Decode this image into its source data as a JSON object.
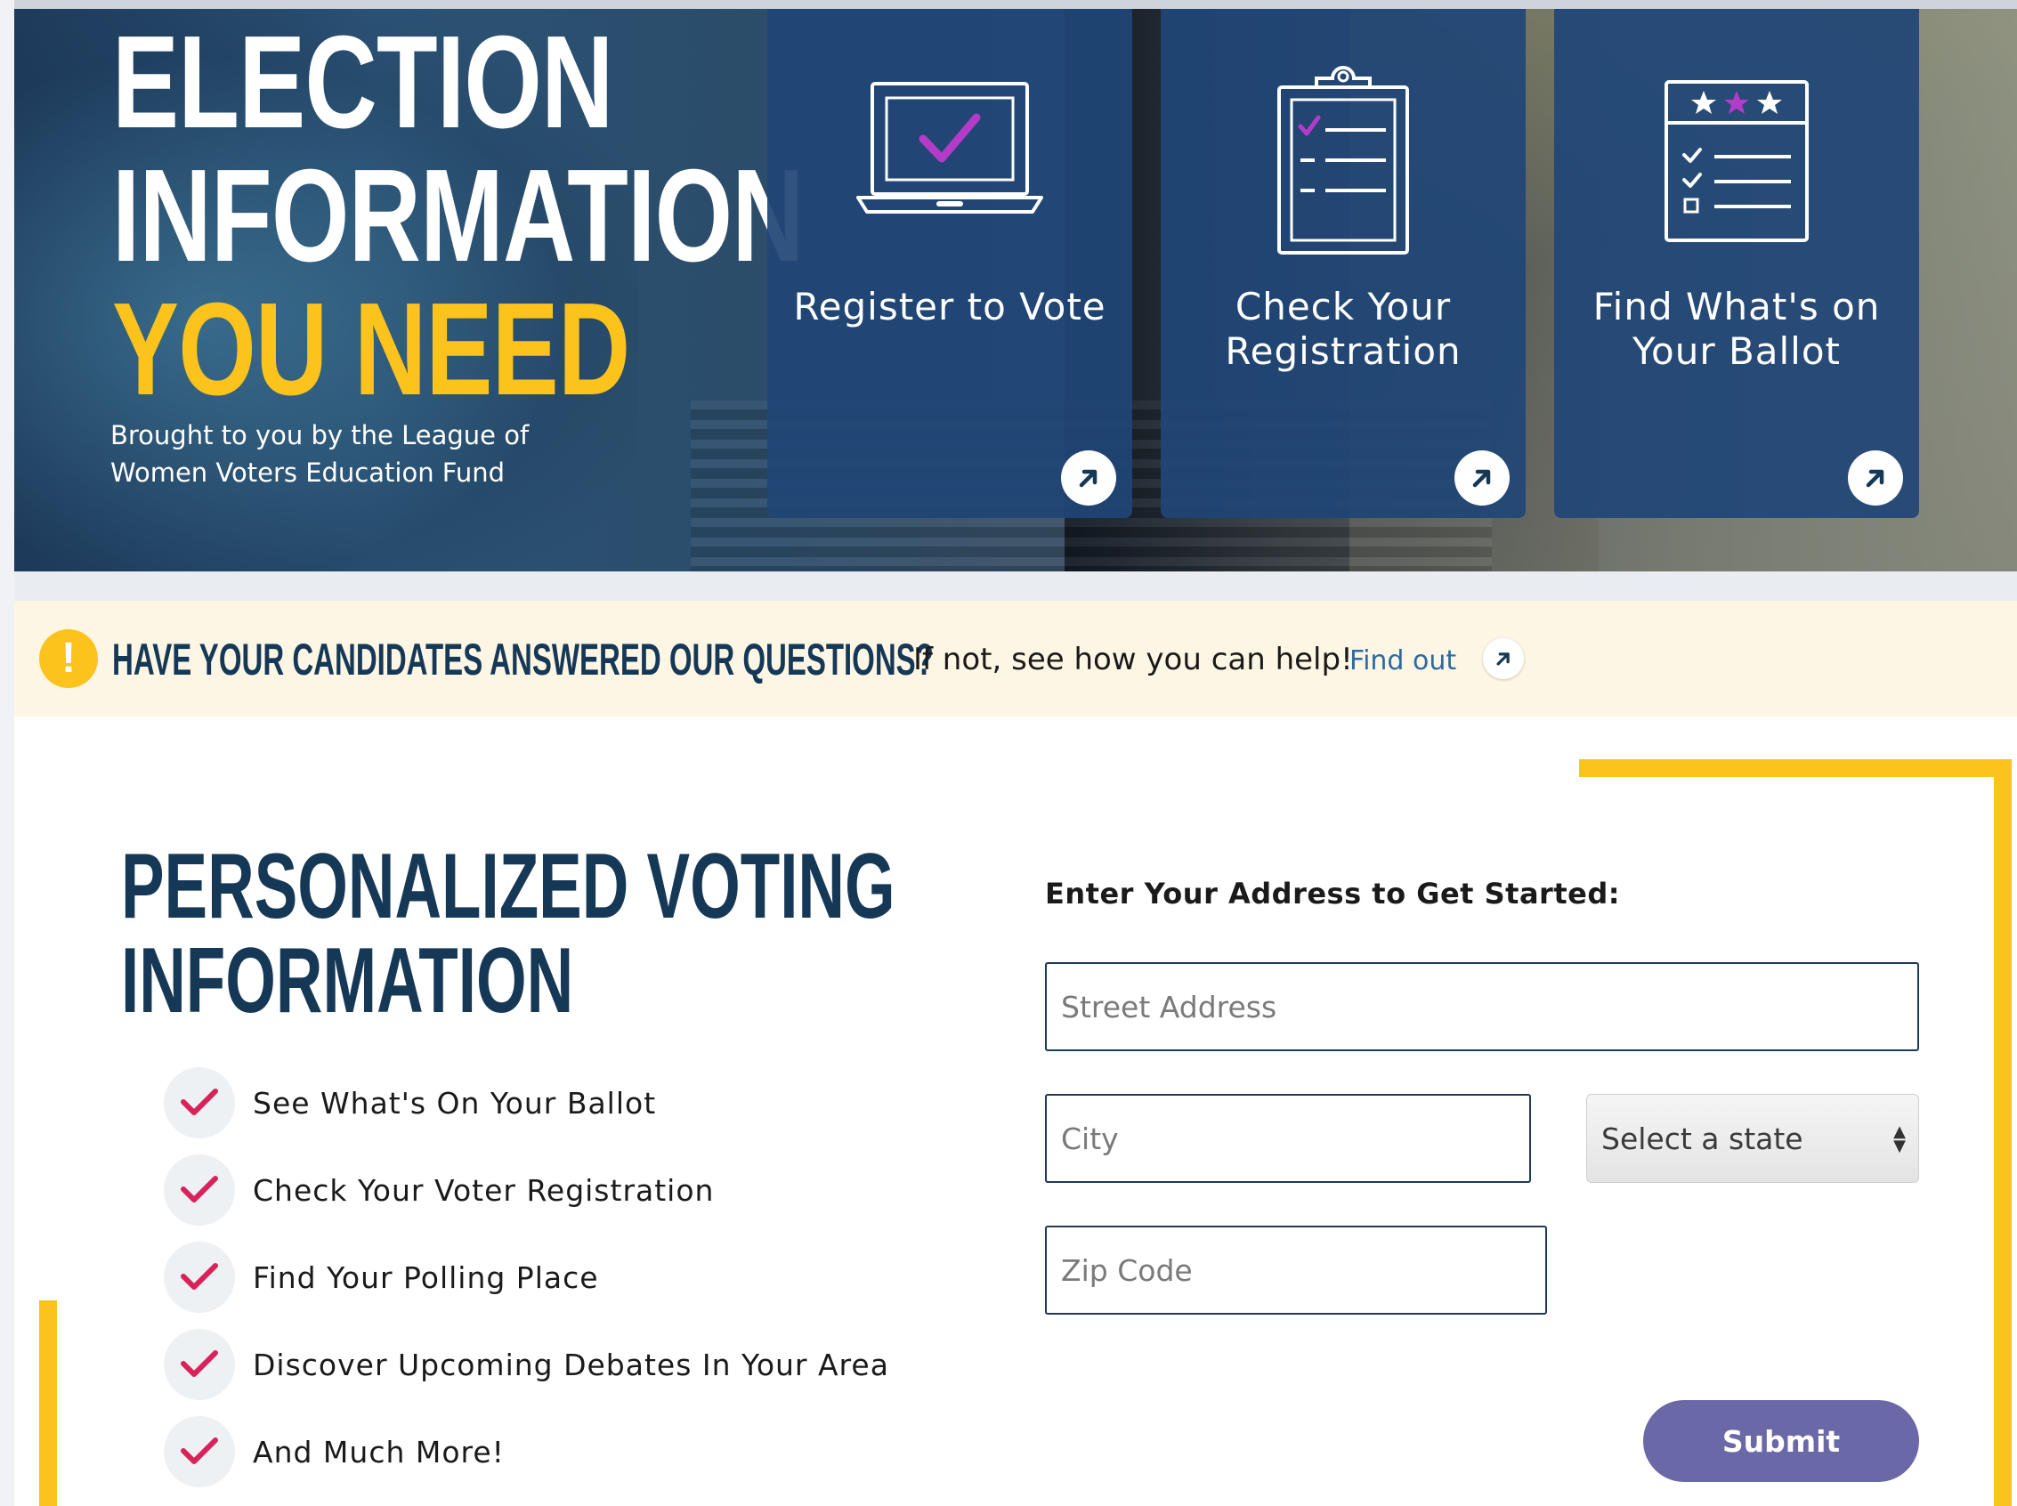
{
  "hero": {
    "title_line1": "ELECTION",
    "title_line2": "INFORMATION",
    "title_line3": "YOU NEED",
    "subtitle": "Brought to you by the League of Women Voters Education Fund",
    "cards": [
      {
        "label": "Register to Vote",
        "icon": "laptop-check-icon"
      },
      {
        "label": "Check Your Registration",
        "icon": "clipboard-checklist-icon"
      },
      {
        "label": "Find What's on Your Ballot",
        "icon": "ballot-stars-icon"
      }
    ]
  },
  "alert": {
    "icon": "exclamation-icon",
    "heading": "HAVE YOUR CANDIDATES ANSWERED OUR QUESTIONS?",
    "text": "If not, see how you can help!",
    "link": "Find out"
  },
  "main": {
    "title_line1": "PERSONALIZED VOTING",
    "title_line2": "INFORMATION",
    "benefits": [
      "See What's On Your Ballot",
      "Check Your Voter Registration",
      "Find Your Polling Place",
      "Discover Upcoming Debates In Your Area",
      "And Much More!"
    ]
  },
  "form": {
    "label": "Enter Your Address to Get Started:",
    "street_placeholder": "Street Address",
    "city_placeholder": "City",
    "state_selected": "Select a state",
    "zip_placeholder": "Zip Code",
    "submit": "Submit"
  },
  "colors": {
    "navy": "#163857",
    "card_blue": "#204676",
    "yellow": "#fbc31c",
    "alert_bg": "#fdf6e4",
    "check_pink": "#d8235a",
    "accent_purple": "#b23cc8",
    "submit_purple": "#6b68a8",
    "link_blue": "#2c6aa0"
  }
}
